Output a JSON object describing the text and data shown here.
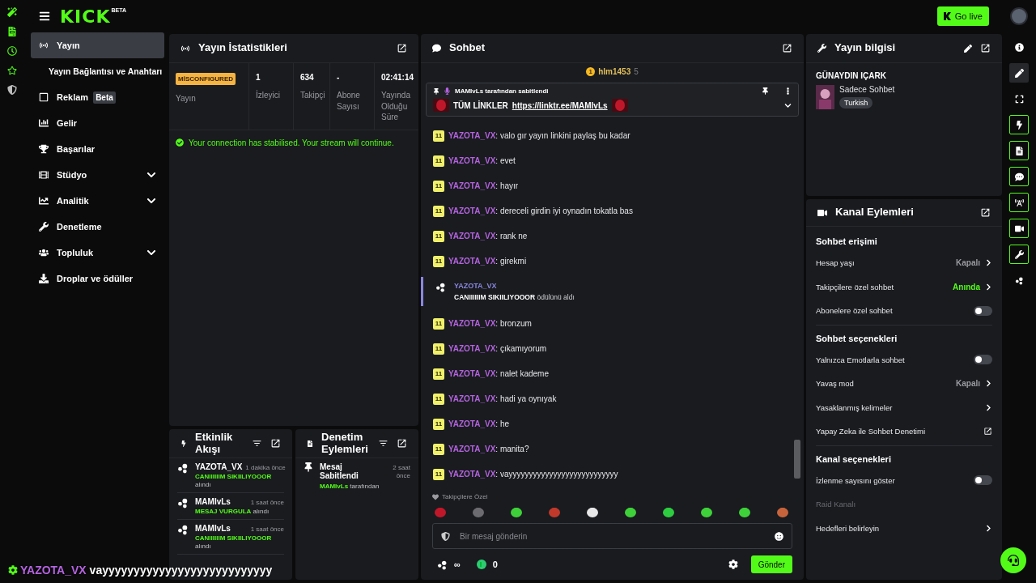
{
  "topbar": {
    "logo": "KICK",
    "logo_badge": "BETA",
    "go_live": "Go live"
  },
  "sidebar": {
    "items": [
      {
        "label": "Yayın",
        "kind": "link",
        "selected": true,
        "children": [
          {
            "label": "Yayın Bağlantısı ve Anahtarı",
            "selected": false
          }
        ]
      },
      {
        "label": "Reklam",
        "kind": "link",
        "selected": false,
        "badge": "Beta"
      },
      {
        "label": "Gelir",
        "kind": "link",
        "selected": false
      },
      {
        "label": "Başarılar",
        "kind": "link",
        "selected": false
      },
      {
        "label": "Stüdyo",
        "kind": "group",
        "selected": false,
        "expanded": false
      },
      {
        "label": "Analitik",
        "kind": "group",
        "selected": false,
        "expanded": false
      },
      {
        "label": "Denetleme",
        "kind": "link",
        "selected": false
      },
      {
        "label": "Topluluk",
        "kind": "group",
        "selected": false,
        "expanded": false
      },
      {
        "label": "Droplar ve ödüller",
        "kind": "link",
        "selected": false
      }
    ]
  },
  "stats": {
    "title": "Yayın İstatistikleri",
    "status": "MİSCONFIGURED",
    "status_label": "Yayın",
    "cells": [
      {
        "value": "1",
        "label": "İzleyici"
      },
      {
        "value": "634",
        "label": "Takipçi"
      },
      {
        "value": "-",
        "label": "Abone Sayısı"
      },
      {
        "value": "02:41:14",
        "label": "Yayında Olduğu Süre"
      }
    ],
    "notice": "Your connection has stabilised. Your stream will continue."
  },
  "activity": {
    "title": "Etkinlik Akışı",
    "items": [
      {
        "name": "YAZOTA_VX",
        "time": "1 dakika önce",
        "reward": "CANIIIIIIM SIKIILIYOOOR",
        "suffix": "alındı"
      },
      {
        "name": "MAMIvLs",
        "time": "1 saat önce",
        "reward": "MESAJ VURGULA",
        "suffix": "alındı"
      },
      {
        "name": "MAMIvLs",
        "time": "1 saat önce",
        "reward": "CANIIIIIIM SIKIILIYOOOR",
        "suffix": "alındı"
      }
    ]
  },
  "moderation": {
    "title": "Denetim Eylemleri",
    "items": [
      {
        "action": "Mesaj Sabitlendi",
        "time": "2 saat önce",
        "by": "MAMIvLs",
        "suffix": "tarafından"
      }
    ]
  },
  "chat": {
    "title": "Sohbet",
    "leader": {
      "rank": "1",
      "name": "hlm1453",
      "count": "5"
    },
    "pinned": {
      "by": "MAMIvLs tarafından sabitlendi",
      "text": "TÜM LİNKLER",
      "link": "https://linktr.ee/MAMIvLs"
    },
    "messages": [
      {
        "kind": "message",
        "badge": "11",
        "user": "YAZOTA_VX",
        "text": ": valo gır yayın linkini paylaş bu kadar"
      },
      {
        "kind": "message",
        "badge": "11",
        "user": "YAZOTA_VX",
        "text": ": evet"
      },
      {
        "kind": "message",
        "badge": "11",
        "user": "YAZOTA_VX",
        "text": ": hayır"
      },
      {
        "kind": "message",
        "badge": "11",
        "user": "YAZOTA_VX",
        "text": ": dereceli girdin iyi oynadın tokatla bas"
      },
      {
        "kind": "message",
        "badge": "11",
        "user": "YAZOTA_VX",
        "text": ": rank ne"
      },
      {
        "kind": "message",
        "badge": "11",
        "user": "YAZOTA_VX",
        "text": ": girekmi"
      },
      {
        "kind": "reward",
        "user": "YAZOTA_VX",
        "text": "**CANIIIIIIM SIKIILIYOOOR** ödülünü aldı"
      },
      {
        "kind": "message",
        "badge": "11",
        "user": "YAZOTA_VX",
        "text": ": bronzum"
      },
      {
        "kind": "message",
        "badge": "11",
        "user": "YAZOTA_VX",
        "text": ": çıkamıyorum"
      },
      {
        "kind": "message",
        "badge": "11",
        "user": "YAZOTA_VX",
        "text": ": nalet kademe"
      },
      {
        "kind": "message",
        "badge": "11",
        "user": "YAZOTA_VX",
        "text": ": hadi ya oynıyak"
      },
      {
        "kind": "message",
        "badge": "11",
        "user": "YAZOTA_VX",
        "text": ": he"
      },
      {
        "kind": "message",
        "badge": "11",
        "user": "YAZOTA_VX",
        "text": ": manita?"
      },
      {
        "kind": "message",
        "badge": "11",
        "user": "YAZOTA_VX",
        "text": ": vayyyyyyyyyyyyyyyyyyyyyyyyyyy"
      }
    ],
    "emote_label": "Takipçilere Özel",
    "emotes": [
      {
        "color": "#c0182a"
      },
      {
        "color": "#6c6c70"
      },
      {
        "color": "#3fd13a"
      },
      {
        "color": "#c0392b"
      },
      {
        "color": "#e8e8e8"
      },
      {
        "color": "#3fd13a"
      },
      {
        "color": "#2ecc40"
      },
      {
        "color": "#3fd13a"
      },
      {
        "color": "#3fd13a"
      },
      {
        "color": "#c8643c"
      }
    ],
    "placeholder": "Bir mesaj gönderin",
    "points": "∞",
    "coins": "0",
    "send": "Gönder"
  },
  "info": {
    "title": "Yayın bilgisi",
    "stream_title": "GÜNAYDIN IÇARK",
    "category": "Sadece Sohbet",
    "tag": "Turkish"
  },
  "channel_actions": {
    "title": "Kanal Eylemleri",
    "sections": [
      {
        "title": "Sohbet erişimi",
        "rows": [
          {
            "kind": "link",
            "label": "Hesap yaşı",
            "value": "Kapalı",
            "color": "#9a9aa0",
            "disabled": false
          },
          {
            "kind": "link",
            "label": "Takipçilere özel sohbet",
            "value": "Anında",
            "color": "#53fc18",
            "disabled": false
          },
          {
            "kind": "toggle",
            "label": "Abonelere özel sohbet",
            "on": false,
            "disabled": false
          }
        ]
      },
      {
        "title": "Sohbet seçenekleri",
        "rows": [
          {
            "kind": "toggle",
            "label": "Yalnızca Emotlarla sohbet",
            "on": false,
            "disabled": false
          },
          {
            "kind": "link",
            "label": "Yavaş mod",
            "value": "Kapalı",
            "color": "#9a9aa0",
            "disabled": false
          },
          {
            "kind": "link",
            "label": "Yasaklanmış kelimeler",
            "disabled": false
          },
          {
            "kind": "external",
            "label": "Yapay Zeka ile Sohbet Denetimi",
            "disabled": false
          }
        ]
      },
      {
        "title": "Kanal seçenekleri",
        "rows": [
          {
            "kind": "toggle",
            "label": "İzlenme sayısını göster",
            "on": false,
            "disabled": false
          },
          {
            "kind": "text",
            "label": "Raid Kanalı",
            "disabled": true
          },
          {
            "kind": "link",
            "label": "Hedefleri belirleyin",
            "disabled": false
          }
        ]
      }
    ]
  },
  "tools": [
    {
      "active": false,
      "selected": false
    },
    {
      "active": false,
      "selected": true
    },
    {
      "active": false,
      "selected": false
    },
    {
      "active": true,
      "selected": false
    },
    {
      "active": true,
      "selected": false
    },
    {
      "active": true,
      "selected": false
    },
    {
      "active": true,
      "selected": false
    },
    {
      "active": true,
      "selected": false
    },
    {
      "active": true,
      "selected": false
    },
    {
      "active": false,
      "selected": false
    }
  ],
  "overlay": {
    "user": "YAZOTA_VX",
    "text": "vayyyyyyyyyyyyyyyyyyyyyyyyyyy"
  }
}
